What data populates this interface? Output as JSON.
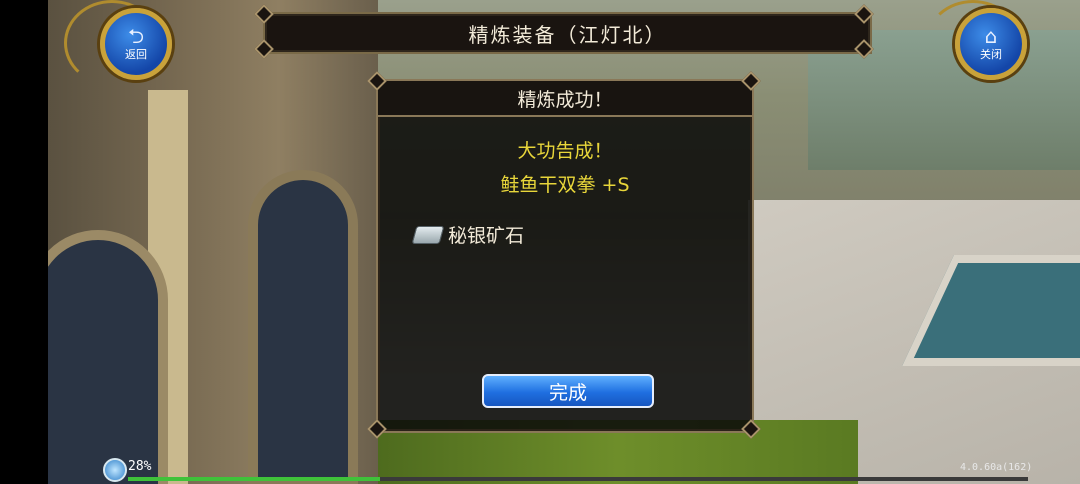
{
  "header": {
    "title": "精炼装备（江灯北）"
  },
  "left_button": {
    "label": "返回",
    "icon": "return-arrow-icon"
  },
  "right_button": {
    "label": "关闭",
    "icon": "home-icon"
  },
  "dialog": {
    "title": "精炼成功！",
    "message_line1": "大功告成！",
    "message_line2": "鲑鱼干双拳 +S",
    "material_label": "秘银矿石",
    "confirm_label": "完成"
  },
  "hud": {
    "progress_text": "28%",
    "progress_fraction": 0.28,
    "version": "4.0.60a(162)"
  },
  "colors": {
    "accent_yellow": "#e8d63a",
    "button_blue": "#1f6fe0",
    "progress_green": "#3fc23a",
    "frame_gold": "#c9a23a"
  }
}
